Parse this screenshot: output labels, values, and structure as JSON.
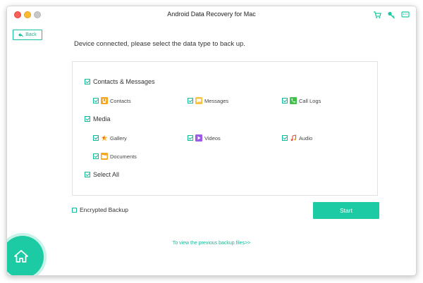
{
  "window": {
    "title": "Android Data Recovery for Mac"
  },
  "toolbar": {
    "icons": [
      "cart-icon",
      "key-icon",
      "feedback-icon"
    ],
    "accent": "#1ccaa3"
  },
  "back": {
    "label": "Back"
  },
  "headline": "Device connected, please select the data type to back up.",
  "groups": {
    "contacts_messages": {
      "label": "Contacts & Messages",
      "items": [
        {
          "label": "Contacts",
          "icon": "contacts-icon",
          "color": "#f5a623",
          "checked": true
        },
        {
          "label": "Messages",
          "icon": "messages-icon",
          "color": "#f5c341",
          "checked": true
        },
        {
          "label": "Call Logs",
          "icon": "call-logs-icon",
          "color": "#3fc14a",
          "checked": true
        }
      ]
    },
    "media": {
      "label": "Media",
      "items": [
        {
          "label": "Gallery",
          "icon": "gallery-icon",
          "color": "#f7b731",
          "checked": true
        },
        {
          "label": "Videos",
          "icon": "videos-icon",
          "color": "#9b59e6",
          "checked": true
        },
        {
          "label": "Audio",
          "icon": "audio-icon",
          "color": "#e74c3c",
          "checked": true
        },
        {
          "label": "Documents",
          "icon": "documents-icon",
          "color": "#f5a623",
          "checked": true
        }
      ]
    },
    "select_all": {
      "label": "Select All",
      "checked": true
    }
  },
  "encrypted_backup": {
    "label": "Encrypted Backup",
    "checked": false
  },
  "start": {
    "label": "Start"
  },
  "previous_link": "To view the previous backup files>>"
}
